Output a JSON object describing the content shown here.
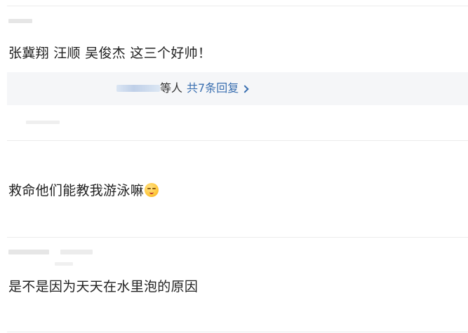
{
  "comments": [
    {
      "text": "张冀翔 汪顺 吴俊杰 这三个好帅！",
      "replies": {
        "suffix": "等人",
        "count_label": "共7条回复"
      }
    },
    {
      "text": "救命他们能教我游泳嘛",
      "emoji": "smiling-face-icon"
    },
    {
      "text": "是不是因为天天在水里泡的原因"
    }
  ],
  "colors": {
    "link": "#3a6fb0",
    "reply_bg": "#f5f6f8",
    "divider": "#ececec"
  }
}
